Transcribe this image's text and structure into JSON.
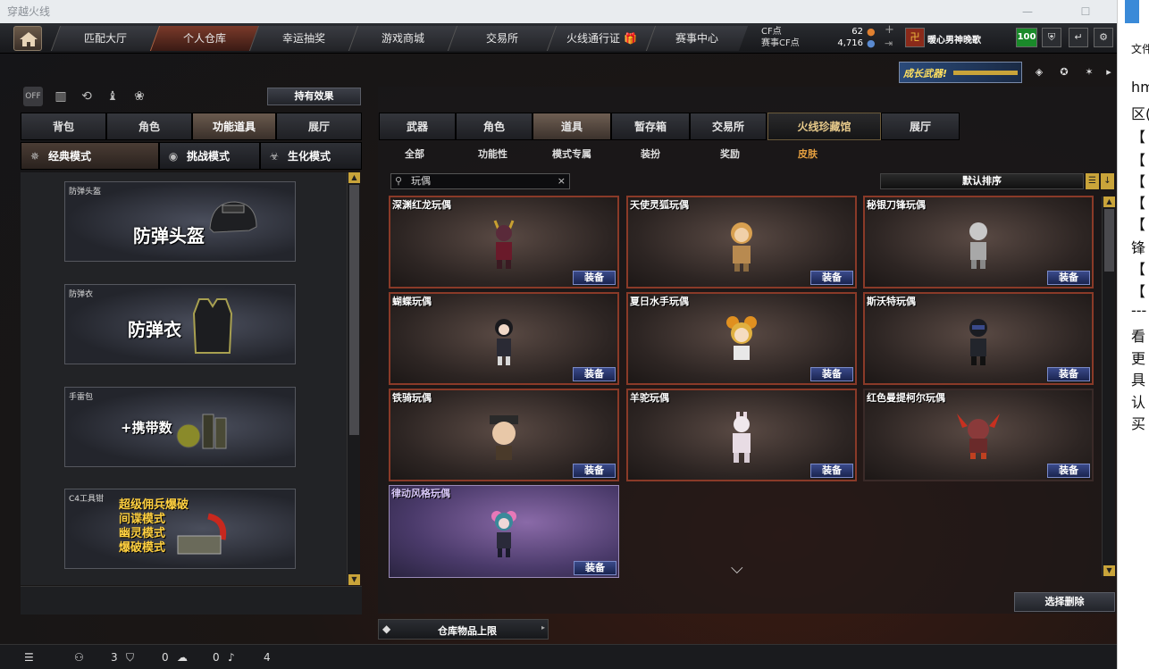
{
  "window": {
    "title": "穿越火线"
  },
  "topnav": {
    "items": [
      "匹配大厅",
      "个人仓库",
      "幸运抽奖",
      "游戏商城",
      "交易所",
      "火线通行证",
      "赛事中心"
    ],
    "active_index": 1
  },
  "currency": {
    "cf_label": "CF点",
    "cf_value": "62",
    "match_label": "赛事CF点",
    "match_value": "4,716"
  },
  "player": {
    "name": "暖心男神晚歌",
    "level_badge": "100"
  },
  "banner": {
    "text": "成长武器!"
  },
  "left": {
    "effect_button": "持有效果",
    "tabs": [
      "背包",
      "角色",
      "功能道具",
      "展厅"
    ],
    "active_tab": 2,
    "modes": [
      "经典模式",
      "挑战模式",
      "生化模式"
    ],
    "active_mode": 0,
    "cards": [
      {
        "caption": "防弹头盔",
        "big": "防弹头盔"
      },
      {
        "caption": "防弹衣",
        "big": "防弹衣"
      },
      {
        "caption": "手雷包",
        "big": "+携带数"
      },
      {
        "caption": "C4工具钳",
        "lines": [
          "超级佣兵爆破",
          "间谍模式",
          "幽灵模式",
          "爆破模式"
        ]
      }
    ]
  },
  "right": {
    "tabs": [
      "武器",
      "角色",
      "道具",
      "暂存箱",
      "交易所",
      "火线珍藏馆",
      "展厅"
    ],
    "active_tab": 2,
    "subtabs": [
      "全部",
      "功能性",
      "模式专属",
      "装扮",
      "奖励",
      "皮肤"
    ],
    "active_subtab": 5,
    "search_value": "玩偶",
    "sort_label": "默认排序",
    "equip_label": "装备",
    "items": [
      {
        "name": "深渊红龙玩偶"
      },
      {
        "name": "天使灵狐玩偶"
      },
      {
        "name": "秘银刀锋玩偶"
      },
      {
        "name": "蝴蝶玩偶"
      },
      {
        "name": "夏日水手玩偶"
      },
      {
        "name": "斯沃特玩偶"
      },
      {
        "name": "铁骑玩偶"
      },
      {
        "name": "羊驼玩偶"
      },
      {
        "name": "红色曼提柯尔玩偶"
      },
      {
        "name": "律动风格玩偶"
      }
    ],
    "delete_button": "选择删除",
    "storage_label": "仓库物品上限"
  },
  "statusbar": {
    "friends": "3",
    "shield": "0",
    "chat": "0",
    "sound": "4"
  },
  "notepad": {
    "menu": "文件",
    "lines": [
      "hm",
      "区(",
      "【",
      "【",
      "【",
      "【",
      "【",
      "锋",
      "【",
      "【",
      "---",
      "看",
      "更",
      "具",
      "认",
      "买"
    ]
  },
  "colors": {
    "accent_orange": "#e6a040",
    "item_border": "#8a3a28",
    "equip_blue": "#2a3a7a"
  }
}
